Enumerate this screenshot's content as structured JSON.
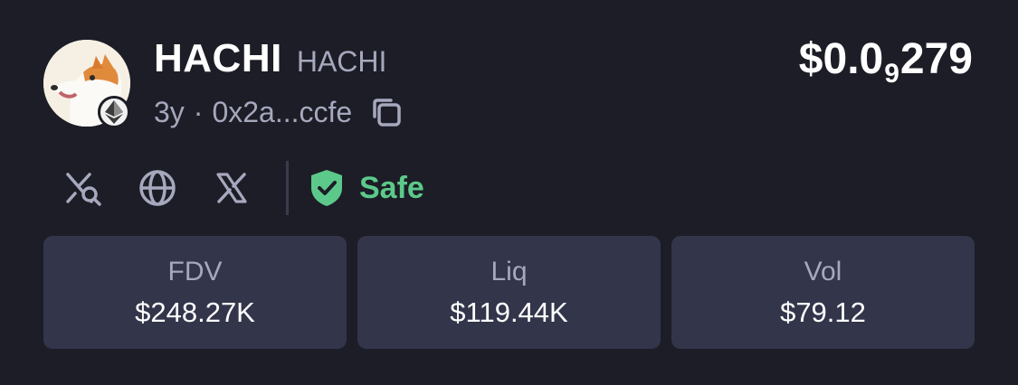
{
  "token": {
    "name": "HACHI",
    "symbol": "HACHI",
    "age": "3y",
    "separator": "·",
    "address": "0x2a...ccfe",
    "chain_icon": "ethereum-icon"
  },
  "price": {
    "prefix": "$0.0",
    "zero_count": "9",
    "digits": "279"
  },
  "links": [
    {
      "icon": "x-search-icon"
    },
    {
      "icon": "globe-icon"
    },
    {
      "icon": "x-logo-icon"
    }
  ],
  "safety": {
    "label": "Safe",
    "color": "#5cc98a",
    "icon": "shield-check-icon"
  },
  "stats": [
    {
      "label": "FDV",
      "value": "$248.27K"
    },
    {
      "label": "Liq",
      "value": "$119.44K"
    },
    {
      "label": "Vol",
      "value": "$79.12"
    }
  ]
}
